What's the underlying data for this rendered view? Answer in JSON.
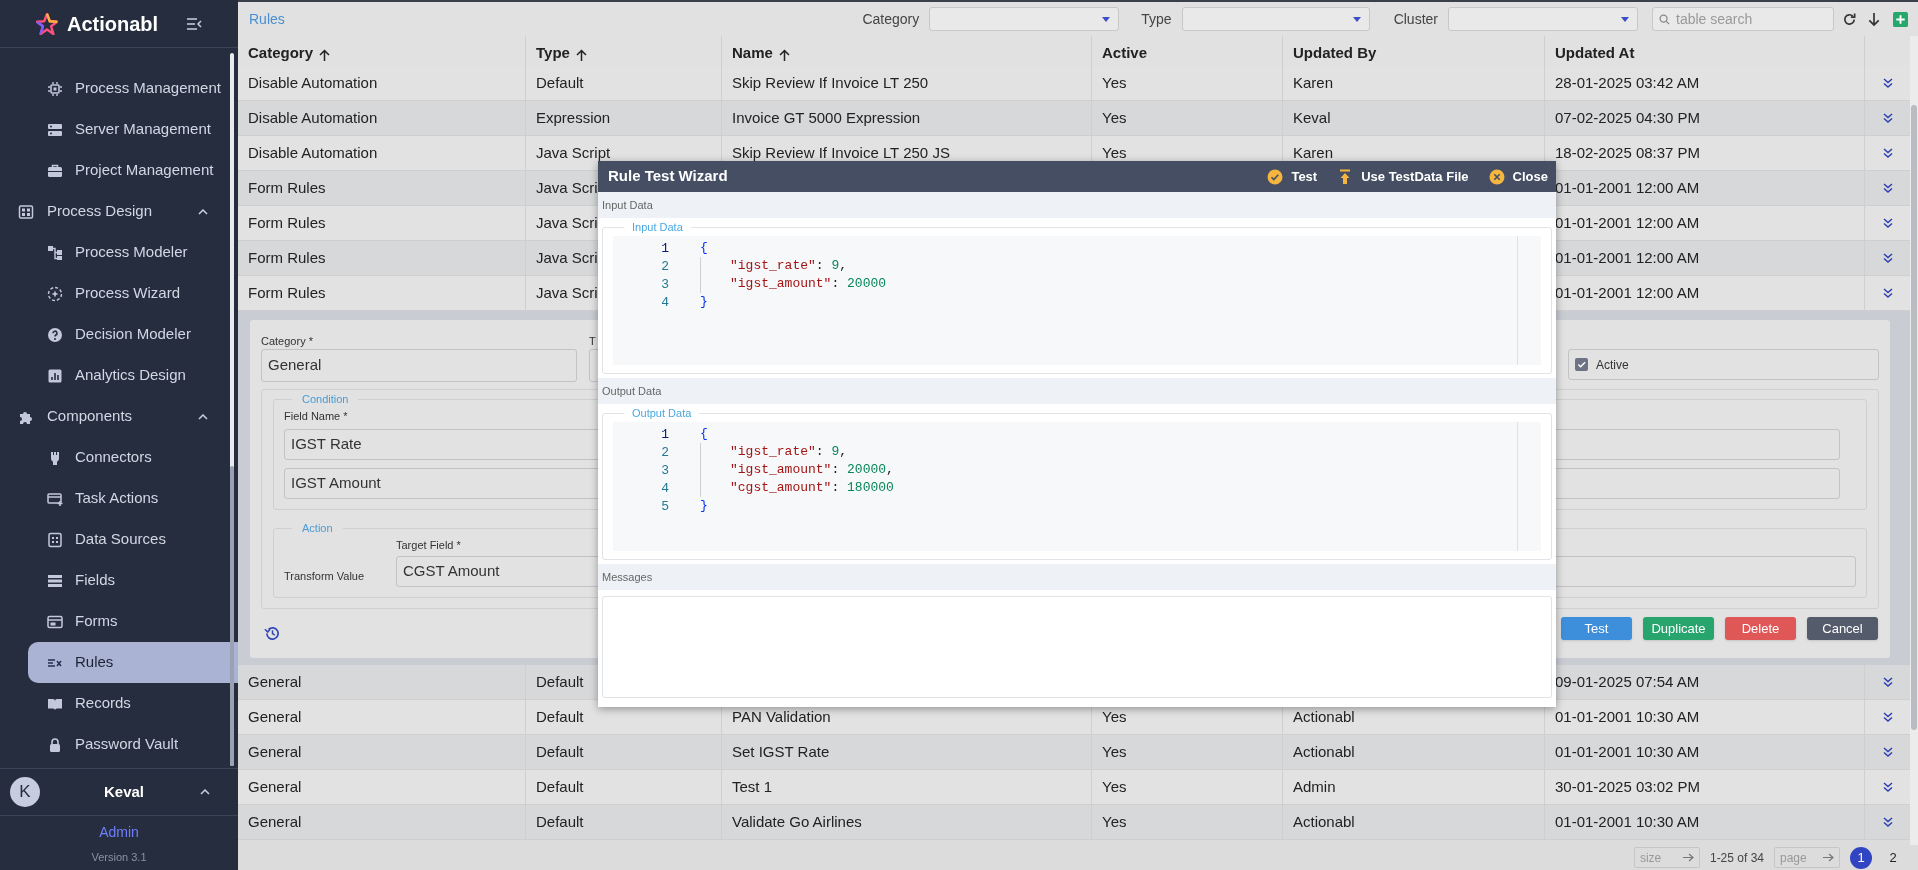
{
  "sidebar": {
    "brand": "Actionabl",
    "sections": [
      {
        "children": [
          {
            "label": "Process Management",
            "selected": false
          },
          {
            "label": "Server Management",
            "selected": false
          },
          {
            "label": "Project Management",
            "selected": false
          }
        ]
      },
      {
        "label": "Process Design",
        "expanded": true,
        "children": [
          {
            "label": "Process Modeler",
            "selected": false
          },
          {
            "label": "Process Wizard",
            "selected": false
          },
          {
            "label": "Decision Modeler",
            "selected": false
          },
          {
            "label": "Analytics Design",
            "selected": false
          }
        ]
      },
      {
        "label": "Components",
        "expanded": true,
        "children": [
          {
            "label": "Connectors",
            "selected": false
          },
          {
            "label": "Task Actions",
            "selected": false
          },
          {
            "label": "Data Sources",
            "selected": false
          },
          {
            "label": "Fields",
            "selected": false
          },
          {
            "label": "Forms",
            "selected": false
          },
          {
            "label": "Rules",
            "selected": true
          },
          {
            "label": "Records",
            "selected": false
          },
          {
            "label": "Password Vault",
            "selected": false
          }
        ]
      }
    ],
    "user": {
      "initial": "K",
      "name": "Keval",
      "expanded": true,
      "role": "Admin",
      "version": "Version 3.1"
    }
  },
  "header": {
    "title": "Rules",
    "filters": [
      {
        "label": "Category"
      },
      {
        "label": "Type"
      },
      {
        "label": "Cluster"
      }
    ],
    "search": {
      "placeholder": "table search"
    }
  },
  "table": {
    "columns": [
      {
        "label": "Category",
        "sorted": true
      },
      {
        "label": "Type",
        "sorted": true
      },
      {
        "label": "Name",
        "sorted": true
      },
      {
        "label": "Active",
        "sorted": false
      },
      {
        "label": "Updated By",
        "sorted": false
      },
      {
        "label": "Updated At",
        "sorted": false
      }
    ],
    "rows": [
      {
        "kind": "row",
        "category": "Disable Automation",
        "type": "Default",
        "name": "Skip Review If Invoice LT 250",
        "active": "Yes",
        "updated_by": "Karen",
        "updated_at": "28-01-2025 03:42 AM"
      },
      {
        "kind": "row",
        "category": "Disable Automation",
        "type": "Expression",
        "name": "Invoice GT 5000 Expression",
        "active": "Yes",
        "updated_by": "Keval",
        "updated_at": "07-02-2025 04:30 PM"
      },
      {
        "kind": "row",
        "category": "Disable Automation",
        "type": "Java Script",
        "name": "Skip Review If Invoice LT 250 JS",
        "active": "Yes",
        "updated_by": "Karen",
        "updated_at": "18-02-2025 08:37 PM"
      },
      {
        "kind": "row",
        "category": "Form Rules",
        "type": "Java Scri",
        "updated_at": "01-01-2001 12:00 AM"
      },
      {
        "kind": "row",
        "category": "Form Rules",
        "type": "Java Scri",
        "updated_at": "01-01-2001 12:00 AM"
      },
      {
        "kind": "row",
        "category": "Form Rules",
        "type": "Java Scri",
        "updated_at": "01-01-2001 12:00 AM"
      },
      {
        "kind": "row",
        "category": "Form Rules",
        "type": "Java Scri",
        "updated_at": "01-01-2001 12:00 AM"
      },
      {
        "kind": "editor",
        "category_label": "Category *",
        "category_value": "General",
        "type_label": "T",
        "active_checkbox": {
          "label": "Active",
          "checked": true
        },
        "condition": {
          "legend": "Condition",
          "field_label": "Field Name *",
          "values": [
            "IGST Rate",
            "IGST Amount"
          ]
        },
        "action": {
          "legend": "Action",
          "transform_label": "Transform Value",
          "target_label": "Target Field *",
          "target_value": "CGST Amount"
        },
        "buttons": [
          {
            "label": "Test",
            "kind": "test"
          },
          {
            "label": "Duplicate",
            "kind": "duplicate"
          },
          {
            "label": "Delete",
            "kind": "delete"
          },
          {
            "label": "Cancel",
            "kind": "cancel"
          }
        ]
      },
      {
        "kind": "row",
        "category": "General",
        "type": "Default",
        "updated_at": "09-01-2025 07:54 AM"
      },
      {
        "kind": "row",
        "category": "General",
        "type": "Default",
        "name": "PAN Validation",
        "active": "Yes",
        "updated_by": "Actionabl",
        "updated_at": "01-01-2001 10:30 AM"
      },
      {
        "kind": "row",
        "category": "General",
        "type": "Default",
        "name": "Set IGST Rate",
        "active": "Yes",
        "updated_by": "Actionabl",
        "updated_at": "01-01-2001 10:30 AM"
      },
      {
        "kind": "row",
        "category": "General",
        "type": "Default",
        "name": "Test 1",
        "active": "Yes",
        "updated_by": "Admin",
        "updated_at": "30-01-2025 03:02 PM"
      },
      {
        "kind": "row",
        "category": "General",
        "type": "Default",
        "name": "Validate Go Airlines",
        "active": "Yes",
        "updated_by": "Actionabl",
        "updated_at": "01-01-2001 10:30 AM"
      }
    ]
  },
  "modal": {
    "title": "Rule Test Wizard",
    "actions": [
      {
        "label": "Test",
        "kind": "test"
      },
      {
        "label": "Use TestData File",
        "kind": "upload"
      },
      {
        "label": "Close",
        "kind": "close"
      }
    ],
    "sections": [
      {
        "kind": "code",
        "heading": "Input Data",
        "legend": "Input Data",
        "lines": [
          {
            "number": "1",
            "indented": false,
            "tokens": [
              {
                "kind": "brace",
                "text": "{"
              }
            ]
          },
          {
            "number": "2",
            "indented": true,
            "tokens": [
              {
                "kind": "key",
                "text": "\"igst_rate\""
              },
              {
                "kind": "punct",
                "text": ": "
              },
              {
                "kind": "number",
                "text": "9"
              },
              {
                "kind": "punct",
                "text": ","
              }
            ]
          },
          {
            "number": "3",
            "indented": true,
            "tokens": [
              {
                "kind": "key",
                "text": "\"igst_amount\""
              },
              {
                "kind": "punct",
                "text": ": "
              },
              {
                "kind": "number",
                "text": "20000"
              }
            ]
          },
          {
            "number": "4",
            "indented": false,
            "tokens": [
              {
                "kind": "brace",
                "text": "}"
              }
            ]
          }
        ]
      },
      {
        "kind": "code",
        "heading": "Output Data",
        "legend": "Output Data",
        "lines": [
          {
            "number": "1",
            "indented": false,
            "tokens": [
              {
                "kind": "brace",
                "text": "{"
              }
            ]
          },
          {
            "number": "2",
            "indented": true,
            "tokens": [
              {
                "kind": "key",
                "text": "\"igst_rate\""
              },
              {
                "kind": "punct",
                "text": ": "
              },
              {
                "kind": "number",
                "text": "9"
              },
              {
                "kind": "punct",
                "text": ","
              }
            ]
          },
          {
            "number": "3",
            "indented": true,
            "tokens": [
              {
                "kind": "key",
                "text": "\"igst_amount\""
              },
              {
                "kind": "punct",
                "text": ": "
              },
              {
                "kind": "number",
                "text": "20000"
              },
              {
                "kind": "punct",
                "text": ","
              }
            ]
          },
          {
            "number": "4",
            "indented": true,
            "tokens": [
              {
                "kind": "key",
                "text": "\"cgst_amount\""
              },
              {
                "kind": "punct",
                "text": ": "
              },
              {
                "kind": "number",
                "text": "180000"
              }
            ]
          },
          {
            "number": "5",
            "indented": false,
            "tokens": [
              {
                "kind": "brace",
                "text": "}"
              }
            ]
          }
        ]
      },
      {
        "kind": "messages",
        "heading": "Messages"
      }
    ]
  },
  "pagination": {
    "size_placeholder": "size",
    "range": "1-25 of 34",
    "page_placeholder": "page",
    "pages": [
      {
        "label": "1",
        "selected": true
      },
      {
        "label": "2",
        "selected": false
      }
    ]
  }
}
